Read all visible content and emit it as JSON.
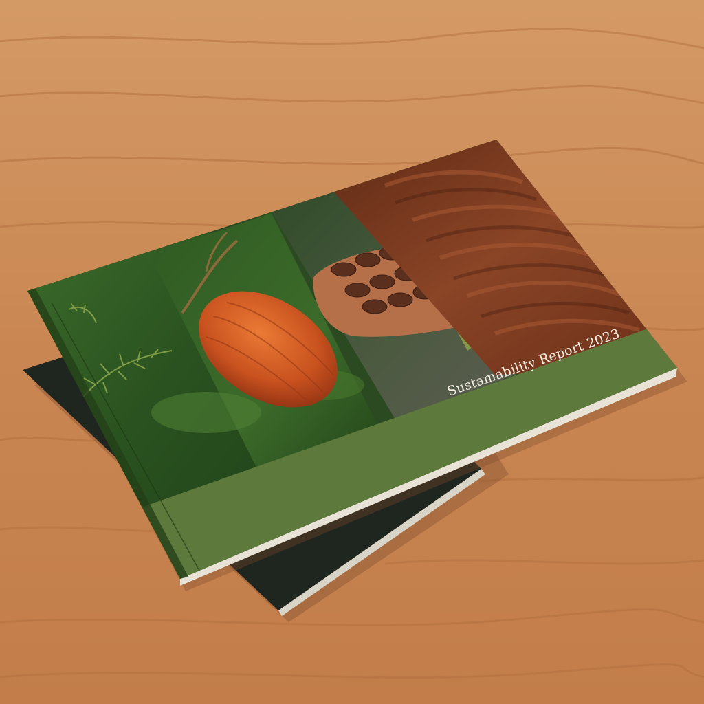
{
  "cover": {
    "title": "Sustamability Report 2023",
    "band_color": "#5d7a3c"
  },
  "scene": {
    "surface": "light wooden table",
    "surface_color": "#c98a55",
    "lower_book_color": "#1f2620"
  },
  "photo_panels": [
    {
      "subject": "moss",
      "color": "#2f5a24"
    },
    {
      "subject": "cacao pod",
      "color": "#c9521f"
    },
    {
      "subject": "cacao beans in hand",
      "color": "#6a3b24"
    },
    {
      "subject": "melted chocolate",
      "color": "#7a3a20"
    }
  ]
}
